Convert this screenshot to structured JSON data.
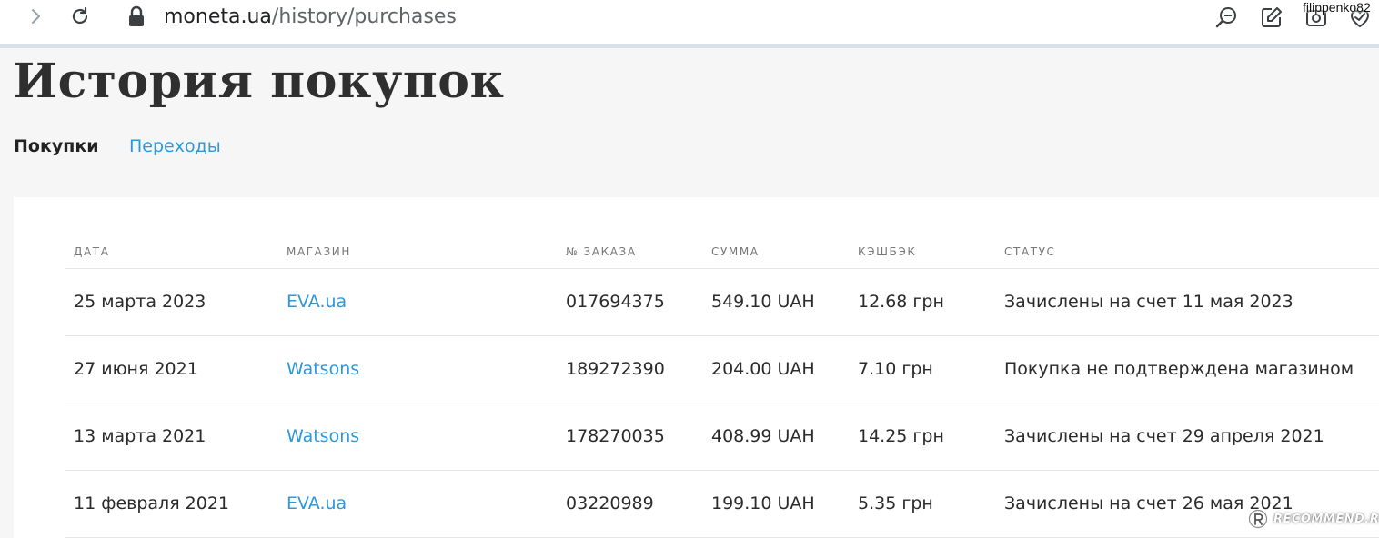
{
  "browser": {
    "url_host": "moneta.ua",
    "url_path": "/history/purchases",
    "username": "filippenko82",
    "icons": [
      "chevron-right-icon",
      "reload-icon",
      "lock-icon",
      "zoom-out-icon",
      "edit-note-icon",
      "camera-icon",
      "heart-check-icon"
    ]
  },
  "page": {
    "title": "История покупок",
    "tabs": [
      {
        "label": "Покупки",
        "active": true
      },
      {
        "label": "Переходы",
        "active": false
      }
    ]
  },
  "table": {
    "headers": {
      "date": "ДАТА",
      "store": "МАГАЗИН",
      "order": "№ ЗАКАЗА",
      "sum": "СУММА",
      "cashback": "КЭШБЭК",
      "status": "СТАТУС"
    },
    "rows": [
      {
        "date": "25 марта 2023",
        "store": "EVA.ua",
        "order": "017694375",
        "sum": "549.10 UAH",
        "cashback": "12.68 грн",
        "status": "Зачислены на счет 11 мая 2023"
      },
      {
        "date": "27 июня 2021",
        "store": "Watsons",
        "order": "189272390",
        "sum": "204.00 UAH",
        "cashback": "7.10 грн",
        "status": "Покупка не подтверждена магазином"
      },
      {
        "date": "13 марта 2021",
        "store": "Watsons",
        "order": "178270035",
        "sum": "408.99 UAH",
        "cashback": "14.25 грн",
        "status": "Зачислены на счет 29 апреля 2021"
      },
      {
        "date": "11 февраля 2021",
        "store": "EVA.ua",
        "order": "03220989",
        "sum": "199.10 UAH",
        "cashback": "5.35 грн",
        "status": "Зачислены на счет 26 мая 2021"
      }
    ]
  },
  "watermark": {
    "text": "RECOMMEND.RU"
  },
  "colors": {
    "link": "#2f97db",
    "title": "#2f2f2f",
    "page_bg": "#f6f6f6",
    "card_bg": "#ffffff",
    "header_text": "#777777",
    "divider": "#d9e1e8"
  }
}
